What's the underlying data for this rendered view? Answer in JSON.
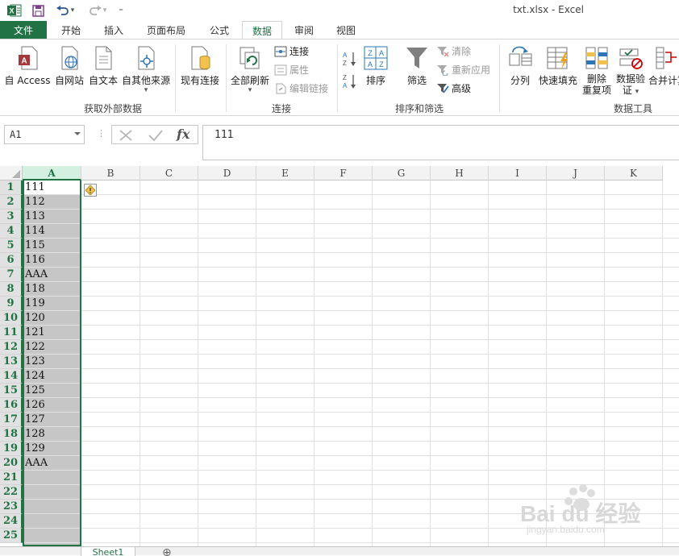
{
  "titlebar": {
    "title": "txt.xlsx - Excel",
    "undo_arrow": "▾",
    "redo_arrow": "▾",
    "customize": "⁼"
  },
  "tabs": [
    {
      "label": "文件"
    },
    {
      "label": "开始"
    },
    {
      "label": "插入"
    },
    {
      "label": "页面布局"
    },
    {
      "label": "公式"
    },
    {
      "label": "数据"
    },
    {
      "label": "审阅"
    },
    {
      "label": "视图"
    }
  ],
  "ribbon": {
    "get_external": {
      "label": "获取外部数据",
      "access": "自 Access",
      "web": "自网站",
      "text": "自文本",
      "other": "自其他来源",
      "other_arrow": "▾",
      "existing": "现有连接"
    },
    "connections": {
      "label": "连接",
      "refresh_all": "全部刷新",
      "refresh_arrow": "▾",
      "connections": "连接",
      "properties": "属性",
      "edit_links": "编辑链接"
    },
    "sort_filter": {
      "label": "排序和筛选",
      "sort": "排序",
      "filter": "筛选",
      "clear": "清除",
      "reapply": "重新应用",
      "advanced": "高级"
    },
    "data_tools": {
      "label": "数据工具",
      "text_to_columns": "分列",
      "flash_fill": "快速填充",
      "remove_dup_1": "删除",
      "remove_dup_2": "重复项",
      "validation_1": "数据验",
      "validation_2": "证",
      "validation_arrow": "▾",
      "consolidate": "合并计算"
    }
  },
  "formula_bar": {
    "name_box": "A1",
    "fx": "fx",
    "value": "111"
  },
  "grid": {
    "columns": [
      "A",
      "B",
      "C",
      "D",
      "E",
      "F",
      "G",
      "H",
      "I",
      "J",
      "K"
    ],
    "rows": [
      "1",
      "2",
      "3",
      "4",
      "5",
      "6",
      "7",
      "8",
      "9",
      "10",
      "11",
      "12",
      "13",
      "14",
      "15",
      "16",
      "17",
      "18",
      "19",
      "20",
      "21",
      "22",
      "23",
      "24",
      "25"
    ],
    "colA": [
      "111",
      "112",
      "113",
      "114",
      "115",
      "116",
      "AAA",
      "118",
      "119",
      "120",
      "121",
      "122",
      "123",
      "124",
      "125",
      "126",
      "127",
      "128",
      "129",
      "AAA"
    ]
  },
  "sheets": {
    "active": "Sheet1",
    "add": "⊕"
  },
  "watermark": {
    "brand": "Bai du 经验",
    "url": "jingyan.baidu.com"
  },
  "colors": {
    "accent": "#217346",
    "selection": "#c6c6c6"
  }
}
